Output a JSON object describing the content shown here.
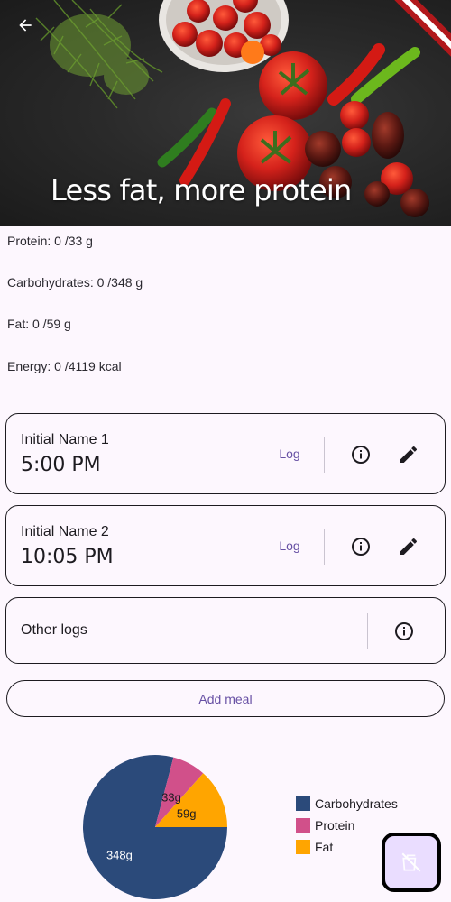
{
  "header": {
    "title": "Less fat, more protein",
    "back_icon": "arrow-back-icon"
  },
  "nutrients": [
    {
      "label": "Protein: 0 /33 g"
    },
    {
      "label": "Carbohydrates: 0 /348 g"
    },
    {
      "label": "Fat: 0 /59 g"
    },
    {
      "label": "Energy: 0 /4119 kcal"
    }
  ],
  "meals": [
    {
      "name": "Initial Name 1",
      "time": "5:00 PM",
      "log_label": "Log",
      "info_icon": "info-icon",
      "edit_icon": "edit-icon"
    },
    {
      "name": "Initial Name 2",
      "time": "10:05 PM",
      "log_label": "Log",
      "info_icon": "info-icon",
      "edit_icon": "edit-icon"
    }
  ],
  "other_logs": {
    "label": "Other logs",
    "info_icon": "info-icon"
  },
  "add_meal_label": "Add meal",
  "colors": {
    "accent": "#6750a4",
    "carbohydrates": "#2b4a7a",
    "protein": "#d1508a",
    "fat": "#ffa500"
  },
  "chart_data": {
    "type": "pie",
    "categories": [
      "Carbohydrates",
      "Protein",
      "Fat"
    ],
    "values": [
      348,
      33,
      59
    ],
    "value_labels": [
      "348g",
      "33g",
      "59g"
    ],
    "legend": "right"
  },
  "fab_icon": "no-food-icon"
}
